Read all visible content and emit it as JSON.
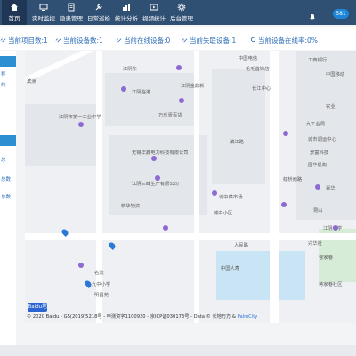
{
  "nav": {
    "items": [
      {
        "label": "首页",
        "icon": "home-icon",
        "active": true
      },
      {
        "label": "实时监控",
        "icon": "monitor-icon"
      },
      {
        "label": "隐患管理",
        "icon": "document-icon"
      },
      {
        "label": "日常巡检",
        "icon": "wrench-icon"
      },
      {
        "label": "统计分析",
        "icon": "chart-icon"
      },
      {
        "label": "视频统计",
        "icon": "video-icon"
      },
      {
        "label": "后台管理",
        "icon": "gear-icon"
      }
    ],
    "notification_count": "581"
  },
  "stats": {
    "project_count": "当前项目数:1",
    "device_count": "当前设备数:1",
    "online_count": "当前在线设备:0",
    "offline_count": "当前失联设备:1",
    "online_rate": "当前设备在线率:0%"
  },
  "leftpanel": {
    "labels": [
      "称",
      "约",
      "总",
      "总数",
      "总数"
    ]
  },
  "map": {
    "pois": [
      "中国电信",
      "江阴东",
      "工商银行",
      "毛毛首饰店",
      "江阴金鼎新",
      "滨洲",
      "长江中心",
      "中国移动",
      "江阴临港",
      "万乐壹百货",
      "农业",
      "江阴市第一工业中学",
      "无锡华鑫电力科技有限公司",
      "江阴三峰生产有限公司",
      "新华物资",
      "城中菜市场",
      "滨江路",
      "城中小区",
      "中国人寿",
      "九工业局",
      "城市调运中心",
      "曹家巷",
      "园华机构",
      "昆山",
      "蒋家巷社区",
      "明昌苑",
      "景富科技",
      "嘉华",
      "江阴中学",
      "兴华社",
      "名流",
      "九中小学",
      "人民路",
      "虹桥南路"
    ],
    "logo": "Baidu地图",
    "copyright": "© 2020 Baidu - GS(2019)5218号 - 甲测资字1100930 - 京ICP证030173号 - Data © 长地万方 &",
    "copyright_link": "PalmCity"
  },
  "colors": {
    "nav_bg": "#2f4f73",
    "accent": "#2b8fd1",
    "stat_text": "#2f6fb7"
  }
}
